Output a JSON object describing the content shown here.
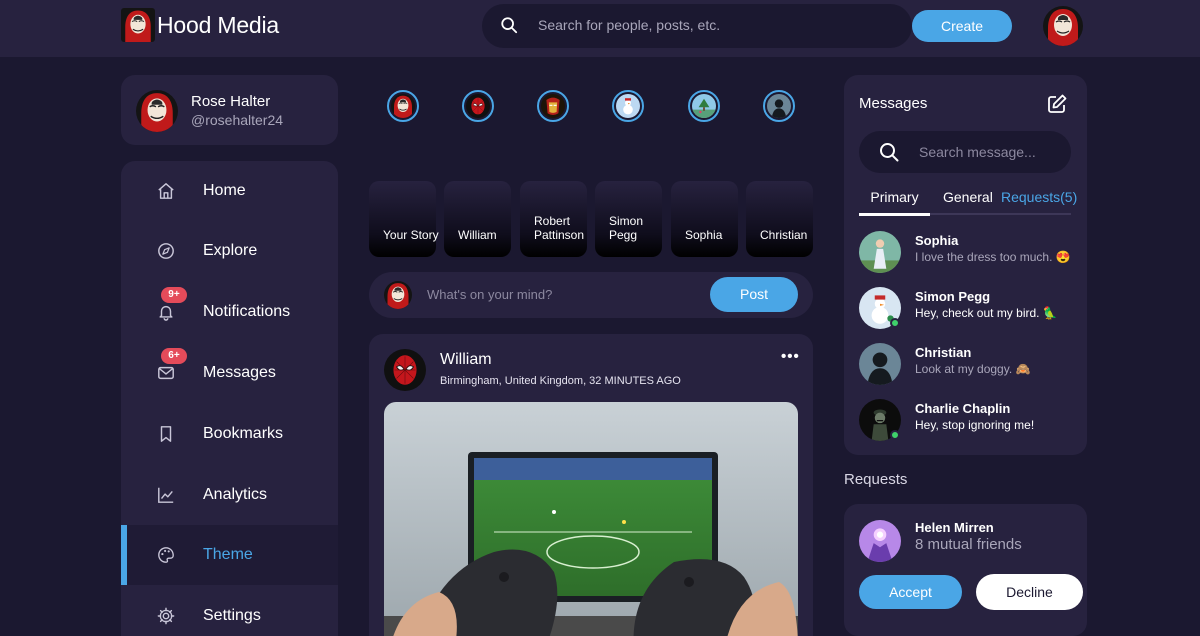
{
  "app": {
    "name": "Hood Media"
  },
  "header": {
    "search_placeholder": "Search for people, posts, etc.",
    "create_label": "Create"
  },
  "profile": {
    "name": "Rose Halter",
    "handle": "@rosehalter24"
  },
  "sidebar": {
    "items": [
      {
        "label": "Home",
        "icon": "home-icon"
      },
      {
        "label": "Explore",
        "icon": "compass-icon"
      },
      {
        "label": "Notifications",
        "icon": "bell-icon",
        "badge": "9+"
      },
      {
        "label": "Messages",
        "icon": "envelope-icon",
        "badge": "6+"
      },
      {
        "label": "Bookmarks",
        "icon": "bookmark-icon"
      },
      {
        "label": "Analytics",
        "icon": "chart-line-icon"
      },
      {
        "label": "Theme",
        "icon": "palette-icon",
        "active": true
      },
      {
        "label": "Settings",
        "icon": "gear-icon"
      }
    ]
  },
  "stories": [
    {
      "label": "Your Story"
    },
    {
      "label": "William"
    },
    {
      "label": "Robert Pattinson"
    },
    {
      "label": "Simon Pegg"
    },
    {
      "label": "Sophia"
    },
    {
      "label": "Christian"
    }
  ],
  "composer": {
    "placeholder": "What's on your mind?",
    "post_label": "Post"
  },
  "feed": {
    "post": {
      "author": "William",
      "meta": "Birmingham, United Kingdom, 32 MINUTES AGO",
      "more": "•••",
      "image": "photo of hands holding game controllers in front of a TV showing a football game"
    }
  },
  "messages": {
    "title": "Messages",
    "search_placeholder": "Search message...",
    "tabs": [
      "Primary",
      "General",
      "Requests(5)"
    ],
    "active_tab": "Primary",
    "items": [
      {
        "name": "Sophia",
        "text": "I love the dress too much. 😍",
        "online": false,
        "unread": false
      },
      {
        "name": "Simon Pegg",
        "text": "Hey, check out my bird. 🦜",
        "online": true,
        "unread": true
      },
      {
        "name": "Christian",
        "text": "Look at my doggy. 🙈",
        "online": false,
        "unread": false
      },
      {
        "name": "Charlie Chaplin",
        "text": "Hey, stop ignoring me!",
        "online": true,
        "unread": true
      }
    ]
  },
  "requests": {
    "title": "Requests",
    "item": {
      "name": "Helen Mirren",
      "mutual": "8 mutual friends",
      "accept_label": "Accept",
      "decline_label": "Decline"
    }
  },
  "colors": {
    "accent": "#4aa6e6",
    "background": "#1b1830",
    "card": "#27223f",
    "badge": "#e44b5a",
    "online": "#3fd16b"
  }
}
